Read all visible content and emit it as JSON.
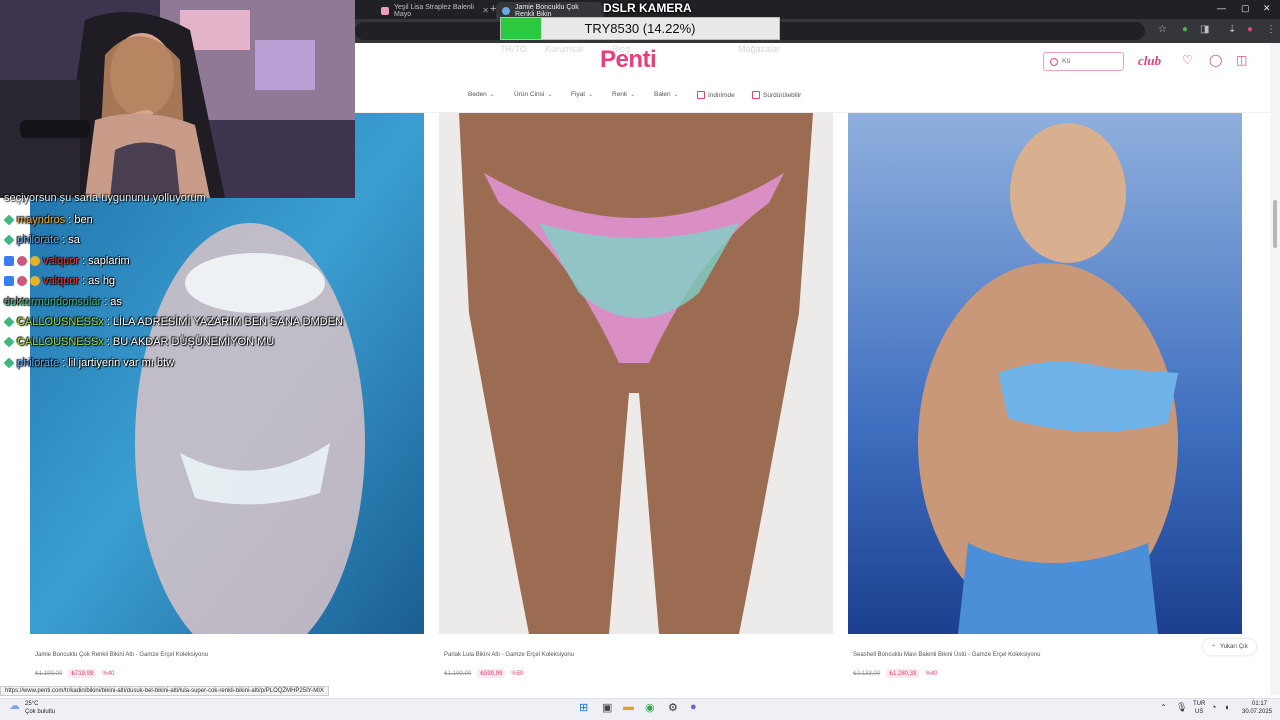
{
  "colors": {
    "brand_pink": "#e2427a",
    "goal_green": "#2bc93f",
    "browser_dark": "#202124"
  },
  "browser": {
    "tabs": [
      {
        "title": "Yeşil Lisa Straplez Balenli Mayo",
        "active": false
      },
      {
        "title": "Jamie Boncuklu Çok Renkli Bikin",
        "active": true
      }
    ],
    "new_tab": "+"
  },
  "overlay": {
    "dslr_label": "DSLR KAMERA",
    "goal_text": "TRY8530 (14.22%)",
    "goal_progress": 0.1422
  },
  "chat": {
    "header_fragment": "seçiyorsun şu sana uygununu yolluyorum",
    "lines": [
      {
        "user": "mayndros",
        "message": "ben",
        "user_color": "#f0b034",
        "badges": [
          "green"
        ]
      },
      {
        "user": "philorate",
        "message": "sa",
        "user_color": "#6aa8e8",
        "badges": [
          "green"
        ]
      },
      {
        "user": "valquor",
        "message": "saplarim",
        "user_color": "#e8362b",
        "badges": [
          "blue",
          "gear",
          "gold"
        ]
      },
      {
        "user": "valquor",
        "message": "as hg",
        "user_color": "#e8362b",
        "badges": [
          "blue",
          "gear",
          "gold"
        ]
      },
      {
        "user": "doktormundomsular",
        "message": "as",
        "user_color": "#43b581",
        "badges": []
      },
      {
        "user": "CALLOUSNESSx",
        "message": "LİLA ADRESİMİ YAZARIM BEN SANA DMDEN",
        "user_color": "#9bd943",
        "badges": [
          "green"
        ]
      },
      {
        "user": "CALLOUSNESSx",
        "message": "BU AKDAR DÜŞÜNEMİYON MU",
        "user_color": "#9bd943",
        "badges": [
          "green"
        ]
      },
      {
        "user": "philorate",
        "message": "lil jartiyerin var mı btw",
        "user_color": "#6aa8e8",
        "badges": [
          "green"
        ]
      }
    ]
  },
  "site": {
    "logo": "Penti",
    "ghost_links": [
      "TR/TO",
      "Kurumsal",
      "Blog",
      "Mağazalar"
    ],
    "search_placeholder": "Kü",
    "club": "club",
    "filters": [
      "Beden",
      "Ürün Cinsi",
      "Fiyat",
      "Renk",
      "Balen"
    ],
    "checkbox_filters": [
      "İndirimde",
      "Sürdürülebilir"
    ],
    "scroll_up": "Yukarı Çık",
    "status_url": "https://www.penti.com/tr/kadin/bikini/bikini-alti/dusuk-bel-bikini-alti/lula-super-cok-renkli-bikini-alti/p/PLOQZMHP25IY-MIX"
  },
  "products": [
    {
      "name": "Jamie Boncuklu Çok Renkli Bikini Altı - Gamze Erçel Koleksiyonu",
      "old_price": "₺1.199,00",
      "new_price": "₺719,99",
      "discount": "%40"
    },
    {
      "name": "Parlak Lula Bikini Altı - Gamze Erçel Koleksiyonu",
      "old_price": "₺1.199,00",
      "new_price": "₺599,99",
      "discount": "%50"
    },
    {
      "name": "Seashell Boncuklu Mavi Balenli Bikini Üstü - Gamze Erçel Koleksiyonu",
      "old_price": "₺2.133,00",
      "new_price": "₺1.280,38",
      "discount": "%40"
    }
  ],
  "taskbar": {
    "weather_temp": "25°C",
    "weather_desc": "Çok bulutlu",
    "lang_top": "TUR",
    "lang_bottom": "US",
    "time": "01:17",
    "date": "30.07.2025"
  }
}
